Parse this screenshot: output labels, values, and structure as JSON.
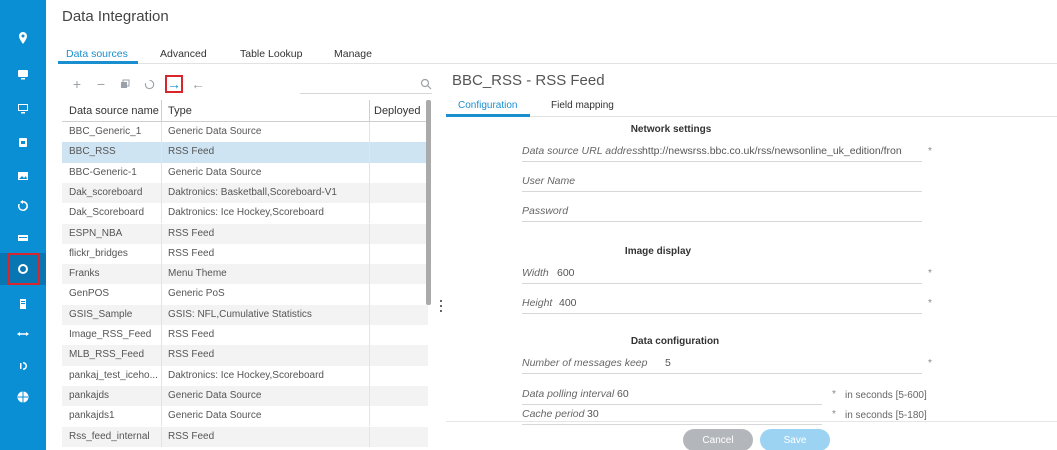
{
  "app": {
    "title": "Data Integration"
  },
  "main_tabs": [
    {
      "label": "Data sources"
    },
    {
      "label": "Advanced"
    },
    {
      "label": "Table Lookup"
    },
    {
      "label": "Manage"
    }
  ],
  "toolbar": {
    "add": "+",
    "remove": "−",
    "copy_icon": "copy-icon",
    "refresh_icon": "refresh-icon",
    "export": "→",
    "import": "←",
    "search_icon": "search-icon"
  },
  "table": {
    "headers": [
      "Data source name",
      "Type",
      "Deployed"
    ],
    "rows": [
      {
        "name": "BBC_Generic_1",
        "type": "Generic Data Source"
      },
      {
        "name": "BBC_RSS",
        "type": "RSS Feed"
      },
      {
        "name": "BBC-Generic-1",
        "type": "Generic Data Source"
      },
      {
        "name": "Dak_scoreboard",
        "type": "Daktronics: Basketball,Scoreboard-V1"
      },
      {
        "name": "Dak_Scoreboard",
        "type": "Daktronics: Ice Hockey,Scoreboard"
      },
      {
        "name": "ESPN_NBA",
        "type": "RSS Feed"
      },
      {
        "name": "flickr_bridges",
        "type": "RSS Feed"
      },
      {
        "name": "Franks",
        "type": "Menu Theme"
      },
      {
        "name": "GenPOS",
        "type": "Generic PoS"
      },
      {
        "name": "GSIS_Sample",
        "type": "GSIS: NFL,Cumulative Statistics"
      },
      {
        "name": "Image_RSS_Feed",
        "type": "RSS Feed"
      },
      {
        "name": "MLB_RSS_Feed",
        "type": "RSS Feed"
      },
      {
        "name": "pankaj_test_iceho...",
        "type": "Daktronics: Ice Hockey,Scoreboard"
      },
      {
        "name": "pankajds",
        "type": "Generic Data Source"
      },
      {
        "name": "pankajds1",
        "type": "Generic Data Source"
      },
      {
        "name": "Rss_feed_internal",
        "type": "RSS Feed"
      }
    ],
    "selected_index": 1
  },
  "detail": {
    "title": "BBC_RSS - RSS Feed",
    "tabs": [
      {
        "label": "Configuration"
      },
      {
        "label": "Field mapping"
      }
    ],
    "network": {
      "heading": "Network settings",
      "url_label": "Data source URL address",
      "url_value": "http://newsrss.bbc.co.uk/rss/newsonline_uk_edition/front_page",
      "user_label": "User Name",
      "password_label": "Password"
    },
    "image": {
      "heading": "Image display",
      "width_label": "Width",
      "width_value": "600",
      "height_label": "Height",
      "height_value": "400"
    },
    "data_config": {
      "heading": "Data configuration",
      "messages_label": "Number of messages keep",
      "messages_value": "5",
      "polling_label": "Data polling interval",
      "polling_value": "60",
      "polling_hint": "in seconds [5-600]",
      "cache_label": "Cache period",
      "cache_value": "30",
      "cache_hint": "in seconds [5-180]"
    },
    "required_mark": "*",
    "cancel": "Cancel",
    "save": "Save"
  },
  "rail_icons": [
    "location-icon",
    "monitor-icon",
    "display-icon",
    "layers-icon",
    "image-icon",
    "history-icon",
    "card-icon",
    "integration-icon",
    "document-icon",
    "arrows-icon",
    "broadcast-icon",
    "globe-icon"
  ],
  "colors": {
    "rail": "#0a8fd4",
    "accent": "#1a8fd0",
    "selected_row": "#cfe4f2",
    "highlight_box": "#d9262c"
  }
}
